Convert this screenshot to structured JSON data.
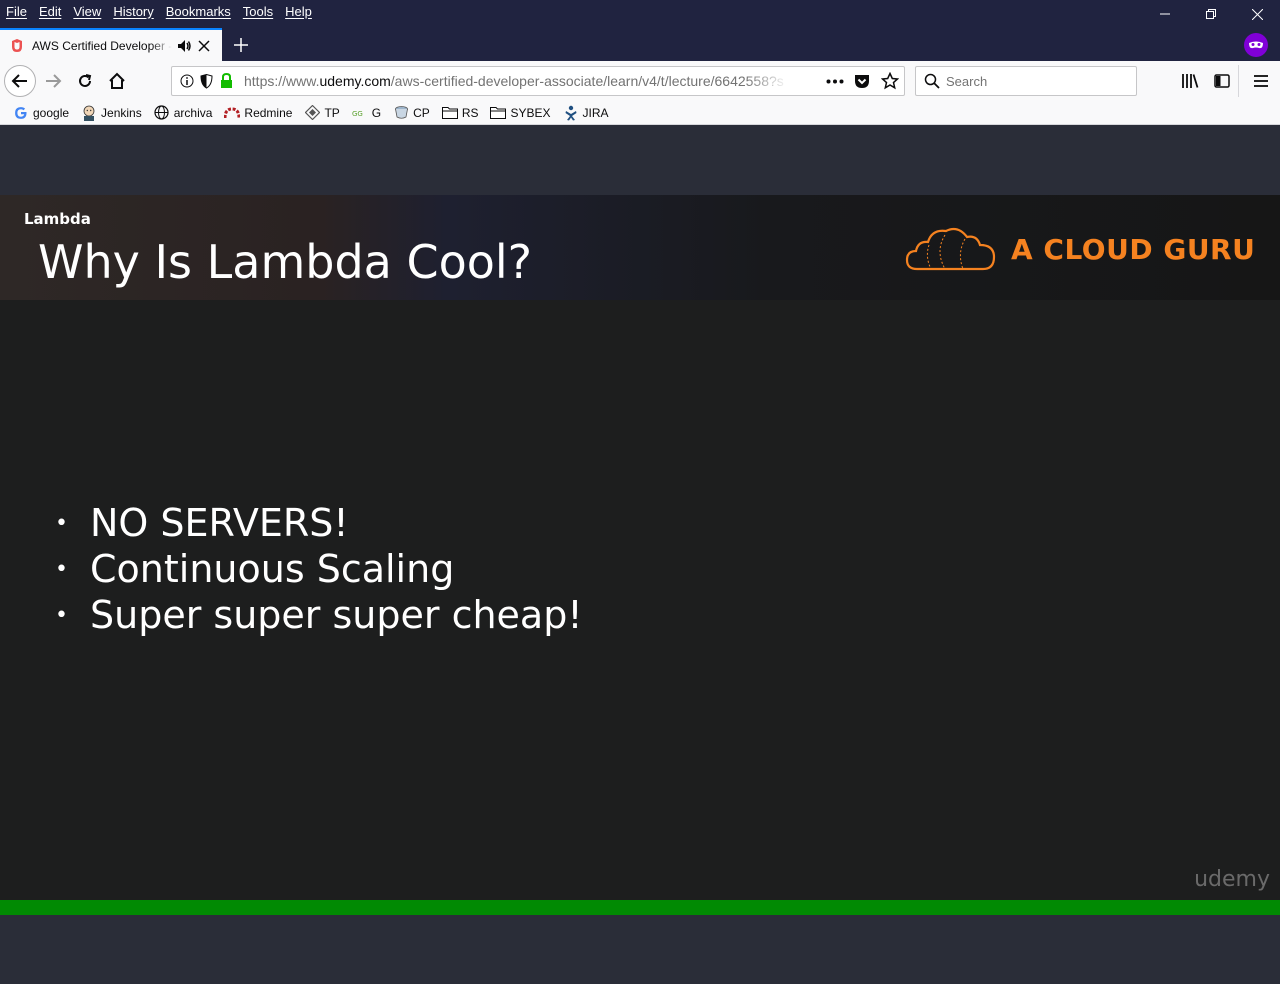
{
  "menu": [
    "File",
    "Edit",
    "View",
    "History",
    "Bookmarks",
    "Tools",
    "Help"
  ],
  "tab": {
    "title": "AWS Certified Developer - Associate"
  },
  "url": {
    "prefix": "https://www.",
    "host": "udemy.com",
    "path": "/aws-certified-developer-associate/learn/v4/t/lecture/6642558?s"
  },
  "search": {
    "placeholder": "Search"
  },
  "bookmarks": [
    {
      "label": "google",
      "icon": "google-icon"
    },
    {
      "label": "Jenkins",
      "icon": "jenkins-icon"
    },
    {
      "label": "archiva",
      "icon": "globe-icon"
    },
    {
      "label": "Redmine",
      "icon": "redmine-icon"
    },
    {
      "label": "TP",
      "icon": "tp-icon"
    },
    {
      "label": "G",
      "icon": "g-icon"
    },
    {
      "label": "CP",
      "icon": "cp-icon"
    },
    {
      "label": "RS",
      "icon": "folder-icon"
    },
    {
      "label": "SYBEX",
      "icon": "folder-icon"
    },
    {
      "label": "JIRA",
      "icon": "jira-icon"
    }
  ],
  "slide": {
    "section": "Lambda",
    "title": "Why Is Lambda Cool?",
    "brand": "A CLOUD GURU",
    "bullets": [
      "NO SERVERS!",
      "Continuous Scaling",
      "Super super super cheap!"
    ],
    "watermark": "udemy"
  },
  "progress": {
    "fraction": 1.0
  },
  "colors": {
    "accent": "#f58220",
    "progress": "#018a03",
    "private": "#8000d7",
    "tab_highlight": "#0a84ff"
  }
}
